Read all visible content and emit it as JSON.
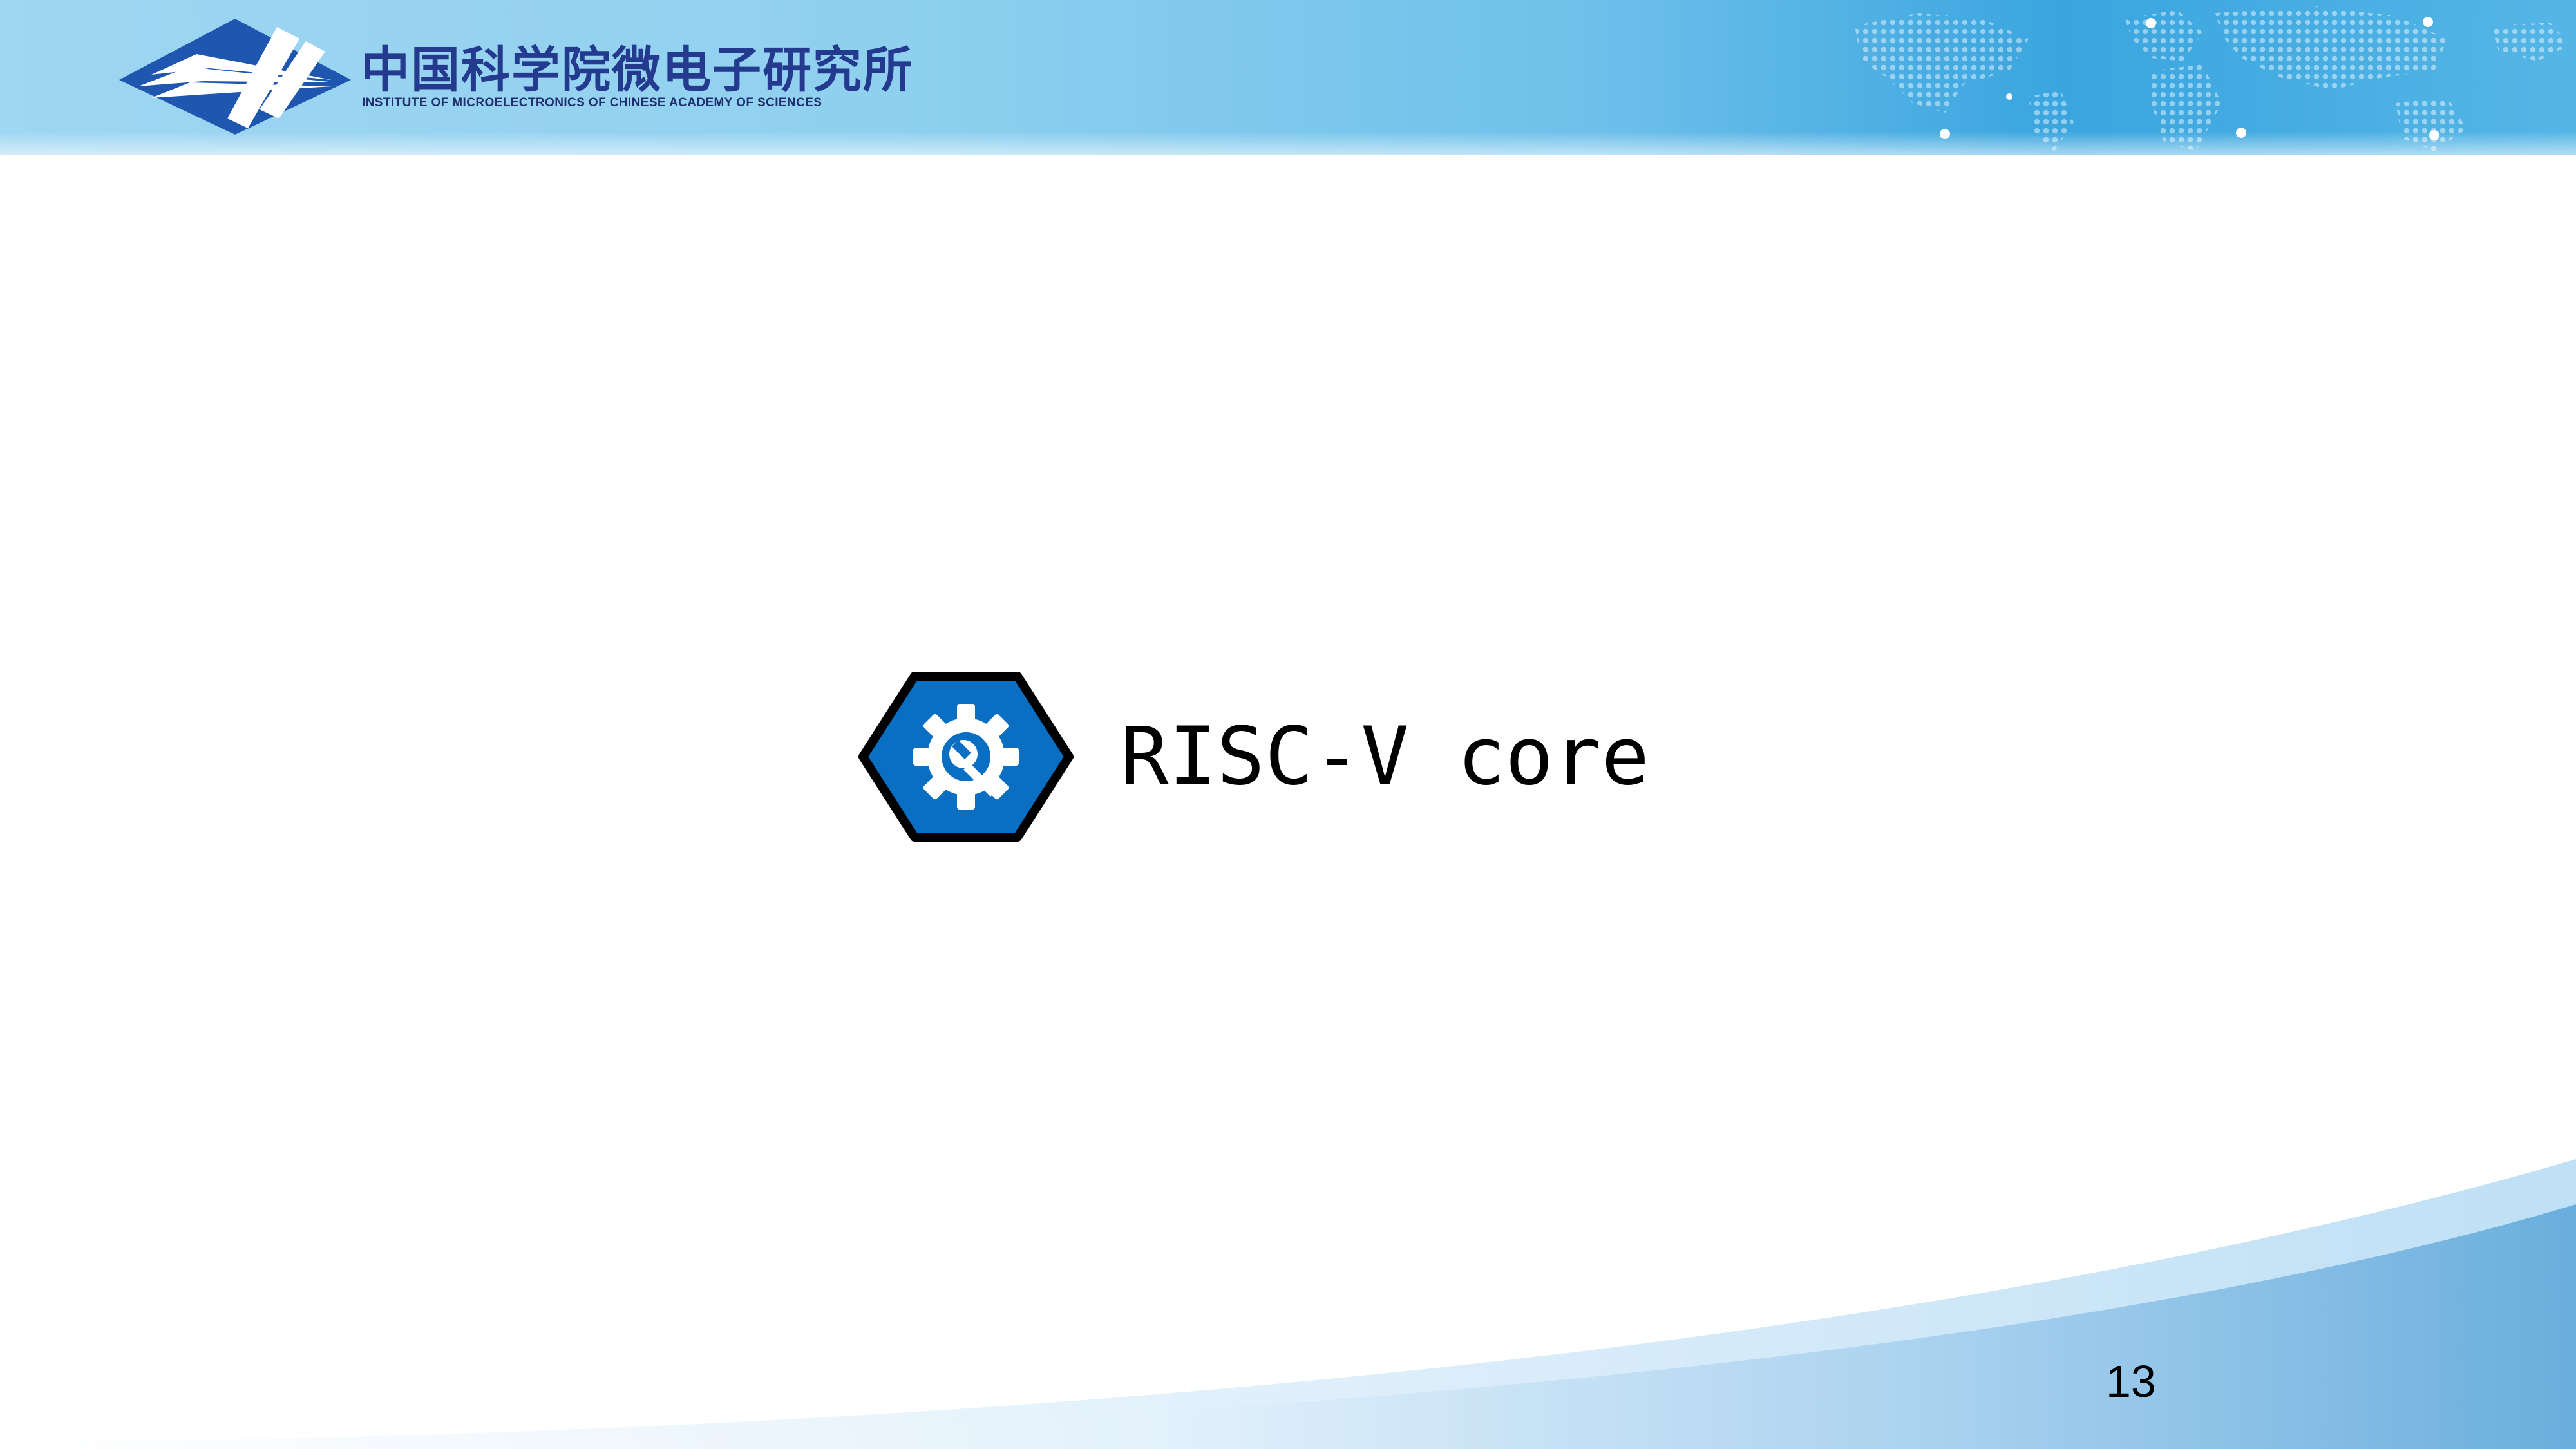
{
  "header": {
    "org_name_cn": "中国科学院微电子研究所",
    "org_name_en": "INSTITUTE OF MICROELECTRONICS OF CHINESE ACADEMY OF SCIENCES",
    "logo_icon": "institute-logo-icon",
    "background_icon": "world-map-dots-icon"
  },
  "section": {
    "icon": "gear-wrench-icon",
    "title": "RISC-V core"
  },
  "footer": {
    "page_number": "13"
  },
  "colors": {
    "header_blue": "#3aa5df",
    "logo_blue": "#1f56b0",
    "org_text": "#233a8f",
    "hex_fill": "#0a6fc2",
    "hex_border": "#000000",
    "swoosh_blue": "#74b3e0"
  }
}
